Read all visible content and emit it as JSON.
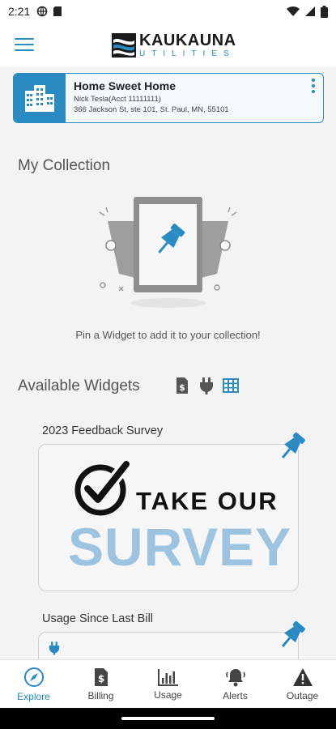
{
  "status_bar": {
    "time": "2:21"
  },
  "header": {
    "logo_name": "KAUKAUNA",
    "logo_sub": "UTILITIES"
  },
  "account": {
    "name": "Home Sweet Home",
    "holder": "Nick Tesla(Acct 11111111)",
    "address": "366 Jackson St, ste 101, St. Paul, MN, 55101"
  },
  "collection": {
    "title": "My Collection",
    "empty_hint": "Pin a Widget to add it to your collection!"
  },
  "available": {
    "title": "Available Widgets"
  },
  "widgets": [
    {
      "label": "2023 Feedback Survey",
      "line1": "TAKE OUR",
      "line2": "SURVEY"
    },
    {
      "label": "Usage Since Last Bill"
    }
  ],
  "nav": [
    {
      "label": "Explore",
      "icon": "compass-icon",
      "active": true
    },
    {
      "label": "Billing",
      "icon": "bill-icon",
      "active": false
    },
    {
      "label": "Usage",
      "icon": "bar-chart-icon",
      "active": false
    },
    {
      "label": "Alerts",
      "icon": "bell-icon",
      "active": false
    },
    {
      "label": "Outage",
      "icon": "warning-icon",
      "active": false
    }
  ],
  "colors": {
    "accent": "#2a8bc2",
    "survey_light": "#9cc4e0"
  }
}
